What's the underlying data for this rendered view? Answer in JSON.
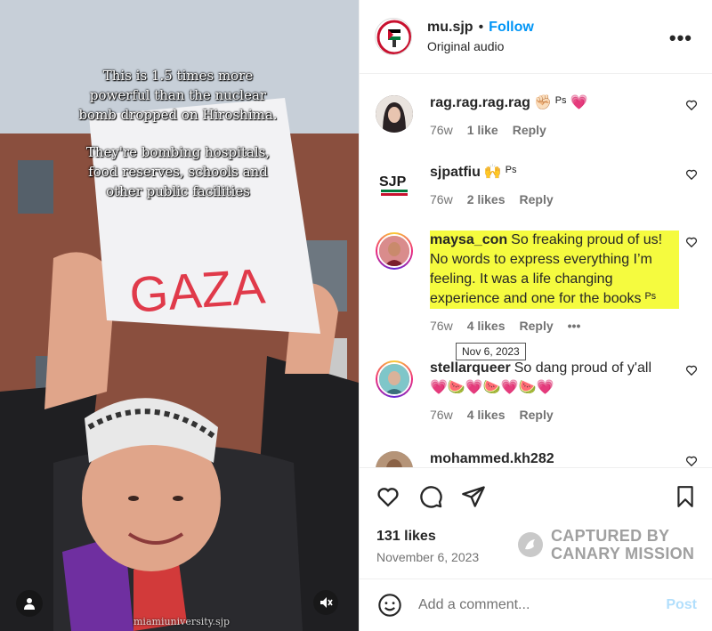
{
  "video": {
    "caption_line1": "This is 1.5 times more powerful than the nuclear bomb dropped on Hiroshima.",
    "caption_line2": "They're bombing hospitals, food reserves, schools and other public facilities",
    "sign_text": "GAZA",
    "watermark": "miamiuniversity.sjp"
  },
  "post": {
    "author": "mu.sjp",
    "dot": "•",
    "follow_label": "Follow",
    "audio": "Original audio",
    "more": "•••"
  },
  "comments": [
    {
      "user": "rag.rag.rag.rag",
      "text": "✊🏻 ᴾˢ 💗",
      "time": "76w",
      "likes": "1 like",
      "reply": "Reply"
    },
    {
      "user": "sjpatfiu",
      "text": "🙌 ᴾˢ",
      "time": "76w",
      "likes": "2 likes",
      "reply": "Reply"
    },
    {
      "user": "maysa_con",
      "text": "So freaking proud of us! No words to express everything I’m feeling. It was a life changing experience and one for the books ᴾˢ",
      "time": "76w",
      "likes": "4 likes",
      "reply": "Reply",
      "more": "•••"
    },
    {
      "user": "stellarqueer",
      "text": "So dang proud of y'all",
      "emojis": "💗🍉💗🍉💗🍉💗",
      "time": "76w",
      "likes": "4 likes",
      "reply": "Reply"
    },
    {
      "user": "mohammed.kh282"
    }
  ],
  "tooltip": "Nov 6, 2023",
  "footer": {
    "likes": "131 likes",
    "date": "November 6, 2023",
    "canary_line1": "CAPTURED BY",
    "canary_line2": "CANARY MISSION",
    "comment_placeholder": "Add a comment...",
    "post_label": "Post"
  },
  "colors": {
    "link_blue": "#0095f6",
    "highlight": "#f5fb3f",
    "post_disabled": "#b2dffc"
  }
}
